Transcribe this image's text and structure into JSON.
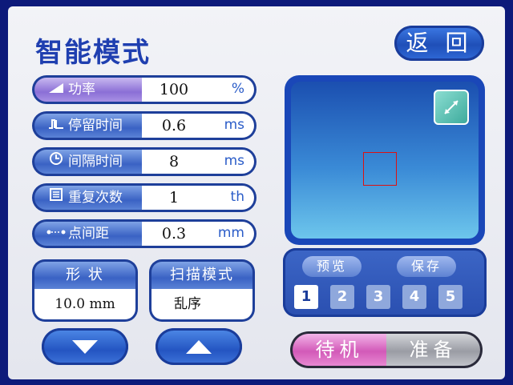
{
  "page": {
    "title": "智能模式",
    "back_label": "返 回"
  },
  "params": [
    {
      "label": "功率",
      "icon": "ramp-icon",
      "value": "100",
      "unit": "%"
    },
    {
      "label": "停留时间",
      "icon": "pulse-icon",
      "value": "0.6",
      "unit": "ms"
    },
    {
      "label": "间隔时间",
      "icon": "clock-icon",
      "value": "8",
      "unit": "ms"
    },
    {
      "label": "重复次数",
      "icon": "repeat-icon",
      "value": "1",
      "unit": "th"
    },
    {
      "label": "点间距",
      "icon": "dot-distance-icon",
      "value": "0.3",
      "unit": "mm"
    }
  ],
  "shape": {
    "label": "形 状",
    "value": "10.0 mm"
  },
  "scan": {
    "label": "扫描模式",
    "value": "乱序"
  },
  "preview": {
    "preview_label": "预览",
    "save_label": "保存",
    "slots": [
      "1",
      "2",
      "3",
      "4",
      "5"
    ],
    "selected_slot": "1"
  },
  "mode": {
    "standby_label": "待机",
    "ready_label": "准备"
  },
  "colors": {
    "accent": "#1f3fb0",
    "standby": "#d25ab8",
    "shape_outline": "#dd1111"
  }
}
